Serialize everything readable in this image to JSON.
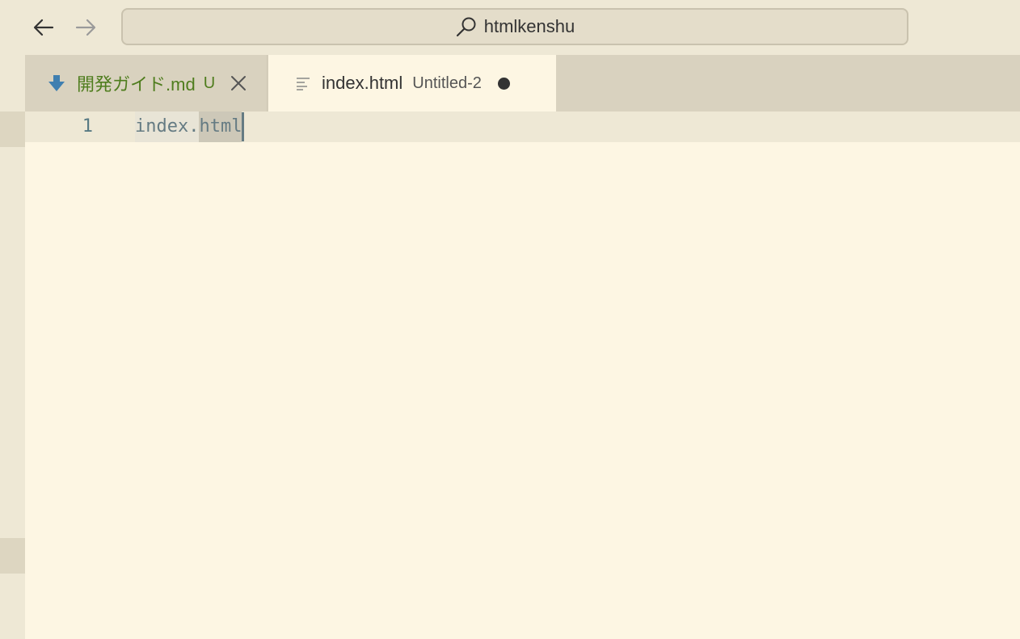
{
  "titlebar": {
    "search_text": "htmlkenshu"
  },
  "tabs": [
    {
      "label": "開発ガイド.md",
      "status": "U",
      "icon": "markdown-download-icon",
      "active": false,
      "color": "#4f7d1e"
    },
    {
      "label": "index.html",
      "description": "Untitled-2",
      "icon": "lines-icon",
      "active": true,
      "dirty": true
    }
  ],
  "editor": {
    "lines": [
      {
        "number": "1",
        "text_plain": "index.",
        "text_selected": "html"
      }
    ]
  },
  "colors": {
    "background": "#fdf6e3",
    "chrome": "#eee8d5",
    "tabbar": "#d9d2bf",
    "accent_icon": "#268bd2"
  }
}
